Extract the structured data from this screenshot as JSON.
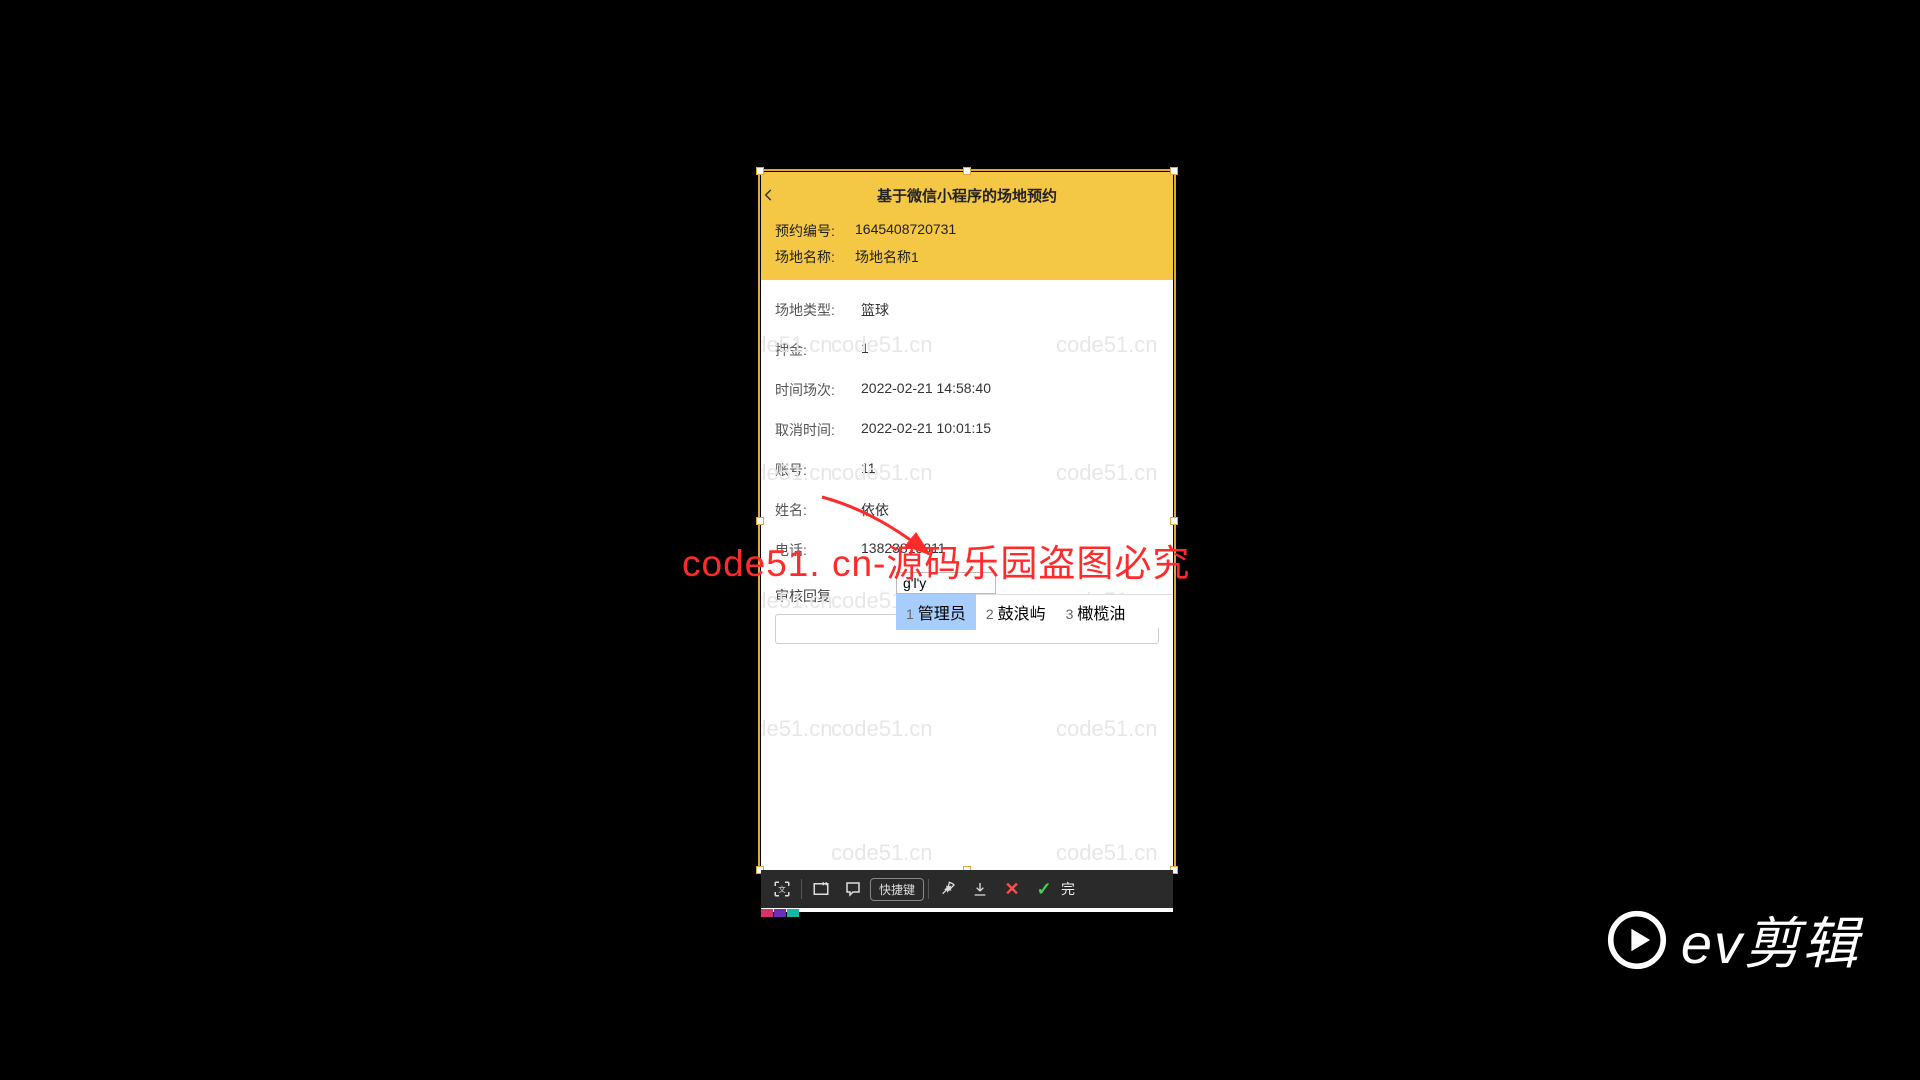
{
  "header": {
    "title": "基于微信小程序的场地预约",
    "rows": [
      {
        "label": "预约编号:",
        "value": "1645408720731"
      },
      {
        "label": "场地名称:",
        "value": "场地名称1"
      }
    ]
  },
  "fields": [
    {
      "label": "场地类型:",
      "value": "篮球"
    },
    {
      "label": "押金:",
      "value": "1"
    },
    {
      "label": "时间场次:",
      "value": "2022-02-21 14:58:40"
    },
    {
      "label": "取消时间:",
      "value": "2022-02-21 10:01:15"
    },
    {
      "label": "账号:",
      "value": "11"
    },
    {
      "label": "姓名:",
      "value": "依依"
    },
    {
      "label": "电话:",
      "value": "13823813811"
    }
  ],
  "reply": {
    "label": "审核回复",
    "value": ""
  },
  "ime": {
    "composition": "g'l'y",
    "candidates": [
      {
        "n": "1",
        "text": "管理员"
      },
      {
        "n": "2",
        "text": "鼓浪屿"
      },
      {
        "n": "3",
        "text": "橄榄油"
      }
    ]
  },
  "shotbar": {
    "shortcut_label": "快捷键",
    "done_label": "完"
  },
  "watermark_faint": "code51.cn",
  "watermark_center": "code51. cn-源码乐园盗图必究",
  "ev_logo_text": "ev剪辑"
}
